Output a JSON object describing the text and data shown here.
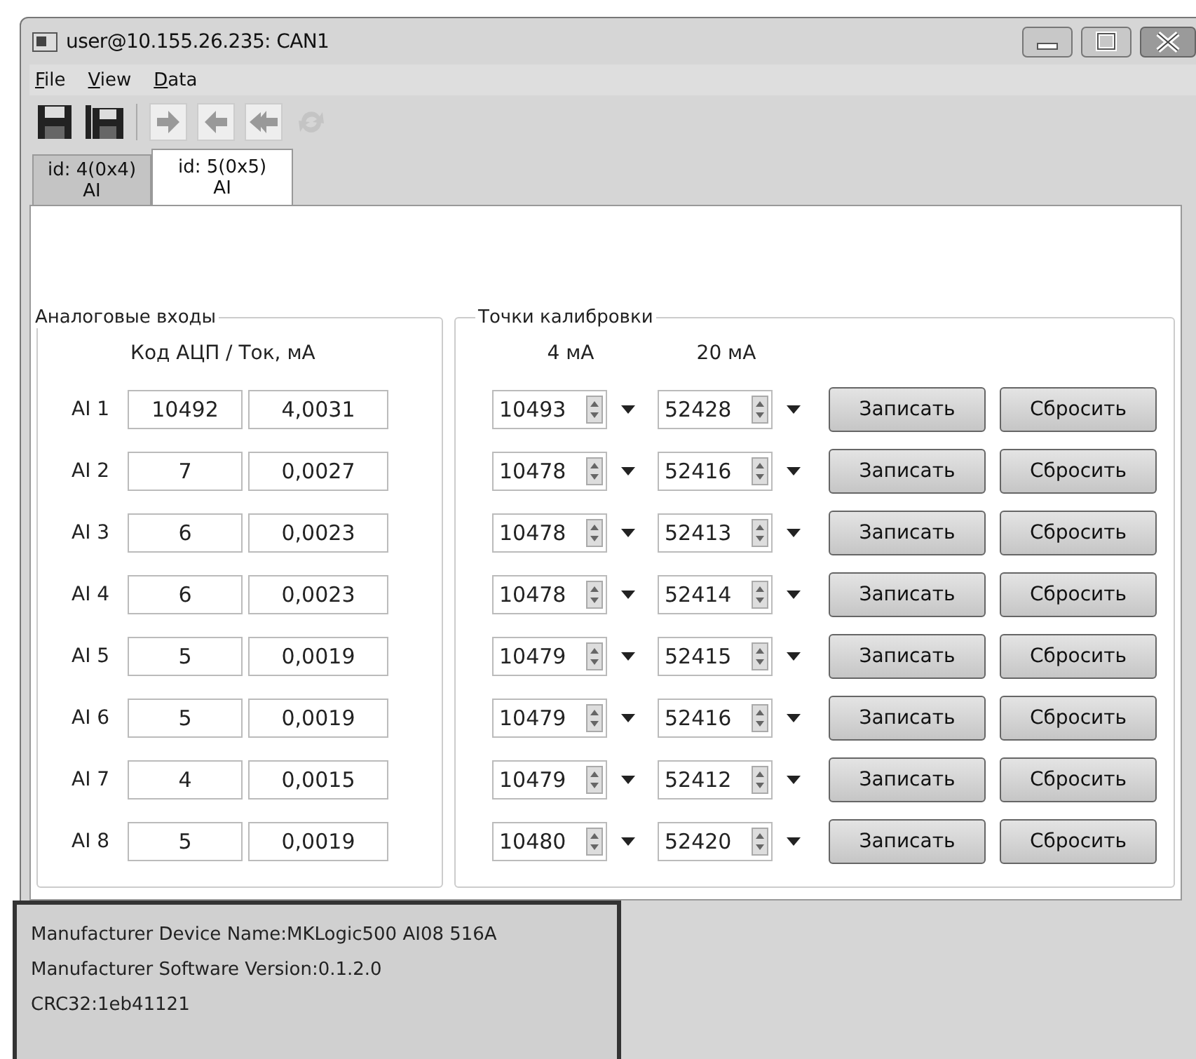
{
  "window": {
    "title": "user@10.155.26.235: CAN1"
  },
  "menu": [
    "File",
    "View",
    "Data"
  ],
  "tabs": [
    {
      "label": "id: 4(0x4)",
      "sublabel": "AI",
      "selected": false
    },
    {
      "label": "id: 5(0x5)",
      "sublabel": "AI",
      "selected": true
    }
  ],
  "inputs_group": {
    "title": "Аналоговые входы",
    "header": "Код АЦП / Ток, мА",
    "rows": [
      {
        "label": "AI 1",
        "code": "10492",
        "current": "4,0031"
      },
      {
        "label": "AI 2",
        "code": "7",
        "current": "0,0027"
      },
      {
        "label": "AI 3",
        "code": "6",
        "current": "0,0023"
      },
      {
        "label": "AI 4",
        "code": "6",
        "current": "0,0023"
      },
      {
        "label": "AI 5",
        "code": "5",
        "current": "0,0019"
      },
      {
        "label": "AI 6",
        "code": "5",
        "current": "0,0019"
      },
      {
        "label": "AI 7",
        "code": "4",
        "current": "0,0015"
      },
      {
        "label": "AI 8",
        "code": "5",
        "current": "0,0019"
      }
    ]
  },
  "calibration_group": {
    "title": "Точки калибровки",
    "columns": [
      "4 мА",
      "20 мА"
    ],
    "rows": [
      {
        "point_4ma": "10493",
        "point_20ma": "52428",
        "write_button": "Записать",
        "reset_button": "Сбросить"
      },
      {
        "point_4ma": "10478",
        "point_20ma": "52416",
        "write_button": "Записать",
        "reset_button": "Сбросить"
      },
      {
        "point_4ma": "10478",
        "point_20ma": "52413",
        "write_button": "Записать",
        "reset_button": "Сбросить"
      },
      {
        "point_4ma": "10478",
        "point_20ma": "52414",
        "write_button": "Записать",
        "reset_button": "Сбросить"
      },
      {
        "point_4ma": "10479",
        "point_20ma": "52415",
        "write_button": "Записать",
        "reset_button": "Сбросить"
      },
      {
        "point_4ma": "10479",
        "point_20ma": "52416",
        "write_button": "Записать",
        "reset_button": "Сбросить"
      },
      {
        "point_4ma": "10479",
        "point_20ma": "52412",
        "write_button": "Записать",
        "reset_button": "Сбросить"
      },
      {
        "point_4ma": "10480",
        "point_20ma": "52420",
        "write_button": "Записать",
        "reset_button": "Сбросить"
      }
    ]
  },
  "info": [
    "Manufacturer Device Name:MKLogic500 AI08 516A",
    "Manufacturer Software Version:0.1.2.0",
    "CRC32:1eb41121"
  ]
}
